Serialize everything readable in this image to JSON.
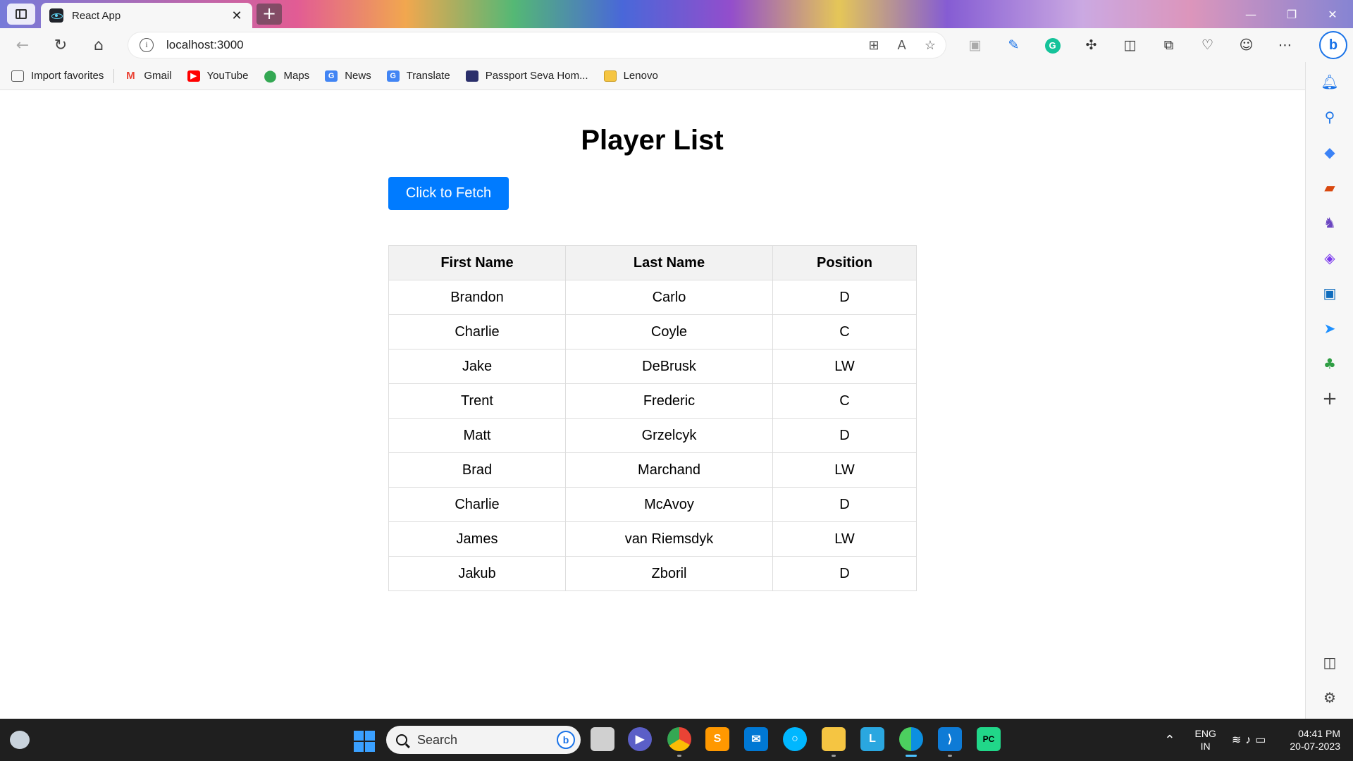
{
  "browser": {
    "tab_title": "React App",
    "tab_close": "✕",
    "new_tab": "+",
    "url": "localhost:3000",
    "window_controls": [
      "—",
      "❐",
      "✕"
    ],
    "favorites": [
      {
        "label": "Import favorites",
        "icon": "import-favorites-icon",
        "color": "#555555"
      },
      {
        "label": "Gmail",
        "icon": "gmail-icon",
        "color": "#ea4335"
      },
      {
        "label": "YouTube",
        "icon": "youtube-icon",
        "color": "#ff0000"
      },
      {
        "label": "Maps",
        "icon": "maps-icon",
        "color": "#34a853"
      },
      {
        "label": "News",
        "icon": "google-news-icon",
        "color": "#4285f4"
      },
      {
        "label": "Translate",
        "icon": "translate-icon",
        "color": "#4285f4"
      },
      {
        "label": "Passport Seva Hom...",
        "icon": "passport-seva-icon",
        "color": "#2b2f6b"
      },
      {
        "label": "Lenovo",
        "icon": "folder-icon",
        "color": "#f5c542"
      }
    ]
  },
  "page": {
    "title": "Player List",
    "fetch_button": "Click to Fetch",
    "columns": [
      "First Name",
      "Last Name",
      "Position"
    ],
    "rows": [
      [
        "Brandon",
        "Carlo",
        "D"
      ],
      [
        "Charlie",
        "Coyle",
        "C"
      ],
      [
        "Jake",
        "DeBrusk",
        "LW"
      ],
      [
        "Trent",
        "Frederic",
        "C"
      ],
      [
        "Matt",
        "Grzelcyk",
        "D"
      ],
      [
        "Brad",
        "Marchand",
        "LW"
      ],
      [
        "Charlie",
        "McAvoy",
        "D"
      ],
      [
        "James",
        "van Riemsdyk",
        "LW"
      ],
      [
        "Jakub",
        "Zboril",
        "D"
      ]
    ],
    "accent_color": "#007bff"
  },
  "taskbar": {
    "search_placeholder": "Search",
    "lang_line1": "ENG",
    "lang_line2": "IN",
    "time": "04:41 PM",
    "date": "20-07-2023"
  }
}
